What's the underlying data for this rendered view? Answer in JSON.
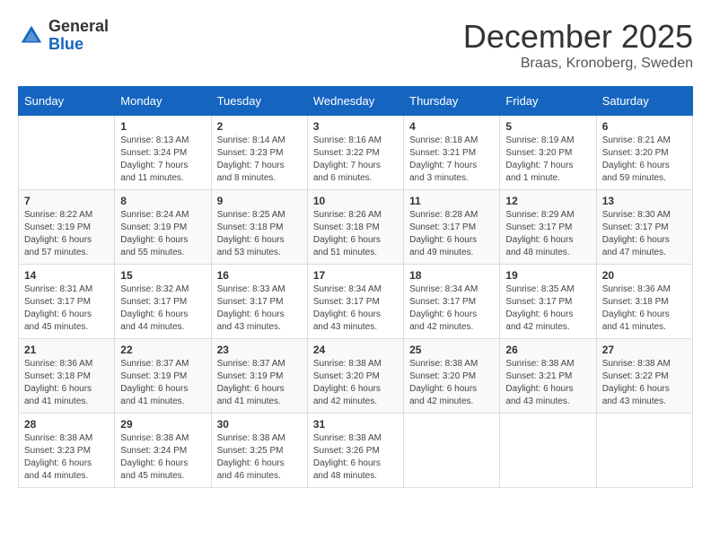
{
  "logo": {
    "general": "General",
    "blue": "Blue"
  },
  "title": "December 2025",
  "location": "Braas, Kronoberg, Sweden",
  "weekdays": [
    "Sunday",
    "Monday",
    "Tuesday",
    "Wednesday",
    "Thursday",
    "Friday",
    "Saturday"
  ],
  "weeks": [
    [
      {
        "day": "",
        "info": ""
      },
      {
        "day": "1",
        "info": "Sunrise: 8:13 AM\nSunset: 3:24 PM\nDaylight: 7 hours\nand 11 minutes."
      },
      {
        "day": "2",
        "info": "Sunrise: 8:14 AM\nSunset: 3:23 PM\nDaylight: 7 hours\nand 8 minutes."
      },
      {
        "day": "3",
        "info": "Sunrise: 8:16 AM\nSunset: 3:22 PM\nDaylight: 7 hours\nand 6 minutes."
      },
      {
        "day": "4",
        "info": "Sunrise: 8:18 AM\nSunset: 3:21 PM\nDaylight: 7 hours\nand 3 minutes."
      },
      {
        "day": "5",
        "info": "Sunrise: 8:19 AM\nSunset: 3:20 PM\nDaylight: 7 hours\nand 1 minute."
      },
      {
        "day": "6",
        "info": "Sunrise: 8:21 AM\nSunset: 3:20 PM\nDaylight: 6 hours\nand 59 minutes."
      }
    ],
    [
      {
        "day": "7",
        "info": "Sunrise: 8:22 AM\nSunset: 3:19 PM\nDaylight: 6 hours\nand 57 minutes."
      },
      {
        "day": "8",
        "info": "Sunrise: 8:24 AM\nSunset: 3:19 PM\nDaylight: 6 hours\nand 55 minutes."
      },
      {
        "day": "9",
        "info": "Sunrise: 8:25 AM\nSunset: 3:18 PM\nDaylight: 6 hours\nand 53 minutes."
      },
      {
        "day": "10",
        "info": "Sunrise: 8:26 AM\nSunset: 3:18 PM\nDaylight: 6 hours\nand 51 minutes."
      },
      {
        "day": "11",
        "info": "Sunrise: 8:28 AM\nSunset: 3:17 PM\nDaylight: 6 hours\nand 49 minutes."
      },
      {
        "day": "12",
        "info": "Sunrise: 8:29 AM\nSunset: 3:17 PM\nDaylight: 6 hours\nand 48 minutes."
      },
      {
        "day": "13",
        "info": "Sunrise: 8:30 AM\nSunset: 3:17 PM\nDaylight: 6 hours\nand 47 minutes."
      }
    ],
    [
      {
        "day": "14",
        "info": "Sunrise: 8:31 AM\nSunset: 3:17 PM\nDaylight: 6 hours\nand 45 minutes."
      },
      {
        "day": "15",
        "info": "Sunrise: 8:32 AM\nSunset: 3:17 PM\nDaylight: 6 hours\nand 44 minutes."
      },
      {
        "day": "16",
        "info": "Sunrise: 8:33 AM\nSunset: 3:17 PM\nDaylight: 6 hours\nand 43 minutes."
      },
      {
        "day": "17",
        "info": "Sunrise: 8:34 AM\nSunset: 3:17 PM\nDaylight: 6 hours\nand 43 minutes."
      },
      {
        "day": "18",
        "info": "Sunrise: 8:34 AM\nSunset: 3:17 PM\nDaylight: 6 hours\nand 42 minutes."
      },
      {
        "day": "19",
        "info": "Sunrise: 8:35 AM\nSunset: 3:17 PM\nDaylight: 6 hours\nand 42 minutes."
      },
      {
        "day": "20",
        "info": "Sunrise: 8:36 AM\nSunset: 3:18 PM\nDaylight: 6 hours\nand 41 minutes."
      }
    ],
    [
      {
        "day": "21",
        "info": "Sunrise: 8:36 AM\nSunset: 3:18 PM\nDaylight: 6 hours\nand 41 minutes."
      },
      {
        "day": "22",
        "info": "Sunrise: 8:37 AM\nSunset: 3:19 PM\nDaylight: 6 hours\nand 41 minutes."
      },
      {
        "day": "23",
        "info": "Sunrise: 8:37 AM\nSunset: 3:19 PM\nDaylight: 6 hours\nand 41 minutes."
      },
      {
        "day": "24",
        "info": "Sunrise: 8:38 AM\nSunset: 3:20 PM\nDaylight: 6 hours\nand 42 minutes."
      },
      {
        "day": "25",
        "info": "Sunrise: 8:38 AM\nSunset: 3:20 PM\nDaylight: 6 hours\nand 42 minutes."
      },
      {
        "day": "26",
        "info": "Sunrise: 8:38 AM\nSunset: 3:21 PM\nDaylight: 6 hours\nand 43 minutes."
      },
      {
        "day": "27",
        "info": "Sunrise: 8:38 AM\nSunset: 3:22 PM\nDaylight: 6 hours\nand 43 minutes."
      }
    ],
    [
      {
        "day": "28",
        "info": "Sunrise: 8:38 AM\nSunset: 3:23 PM\nDaylight: 6 hours\nand 44 minutes."
      },
      {
        "day": "29",
        "info": "Sunrise: 8:38 AM\nSunset: 3:24 PM\nDaylight: 6 hours\nand 45 minutes."
      },
      {
        "day": "30",
        "info": "Sunrise: 8:38 AM\nSunset: 3:25 PM\nDaylight: 6 hours\nand 46 minutes."
      },
      {
        "day": "31",
        "info": "Sunrise: 8:38 AM\nSunset: 3:26 PM\nDaylight: 6 hours\nand 48 minutes."
      },
      {
        "day": "",
        "info": ""
      },
      {
        "day": "",
        "info": ""
      },
      {
        "day": "",
        "info": ""
      }
    ]
  ]
}
